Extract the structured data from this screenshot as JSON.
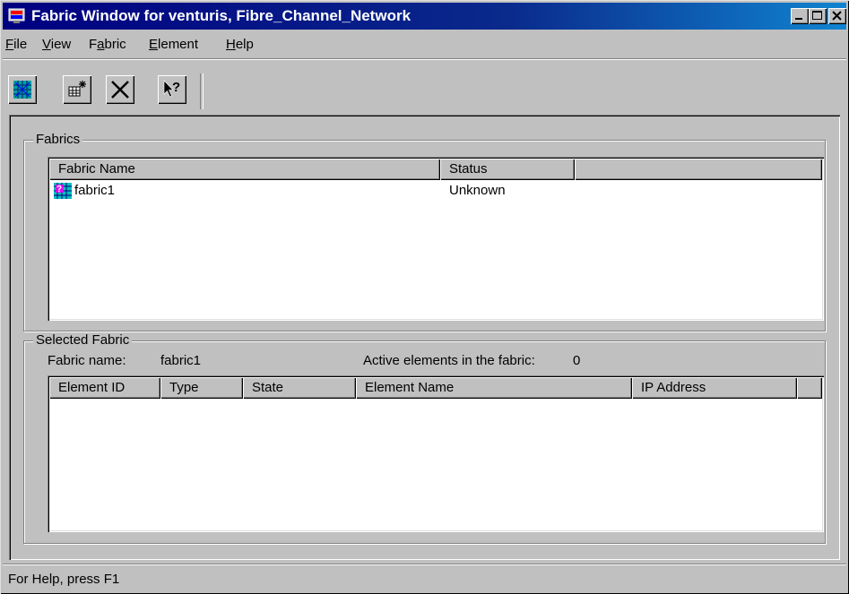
{
  "window": {
    "title": "Fabric Window for venturis, Fibre_Channel_Network",
    "app_icon": "fabric-app-icon",
    "controls": [
      "minimize-icon",
      "maximize-icon",
      "close-icon"
    ]
  },
  "menu": {
    "items": [
      {
        "label": "File",
        "mnemonic": "F",
        "rest": "ile"
      },
      {
        "label": "View",
        "mnemonic": "V",
        "rest": "iew"
      },
      {
        "label": "Fabric",
        "mnemonic": "a",
        "prefix": "F",
        "rest": "bric"
      },
      {
        "label": "Element",
        "mnemonic": "E",
        "rest": "lement"
      },
      {
        "label": "Help",
        "mnemonic": "H",
        "rest": "elp"
      }
    ]
  },
  "toolbar": {
    "buttons": [
      "fabric-view-icon",
      "discover-element-icon",
      "delete-icon",
      "context-help-icon"
    ]
  },
  "fabrics": {
    "group_label": "Fabrics",
    "columns": [
      "Fabric Name",
      "Status",
      ""
    ],
    "rows": [
      {
        "name": "fabric1",
        "status": "Unknown",
        "icon": "fabric-icon"
      }
    ]
  },
  "selected_fabric": {
    "group_label": "Selected Fabric",
    "fabric_name_label": "Fabric name:",
    "fabric_name_value": "fabric1",
    "active_label": "Active elements in the fabric:",
    "active_value": "0",
    "columns": [
      "Element ID",
      "Type",
      "State",
      "Element Name",
      "IP Address",
      ""
    ],
    "rows": []
  },
  "statusbar": {
    "text": "For Help, press F1"
  },
  "colors": {
    "titlebar_start": "#000080",
    "titlebar_end": "#1084d0",
    "face": "#c0c0c0"
  }
}
